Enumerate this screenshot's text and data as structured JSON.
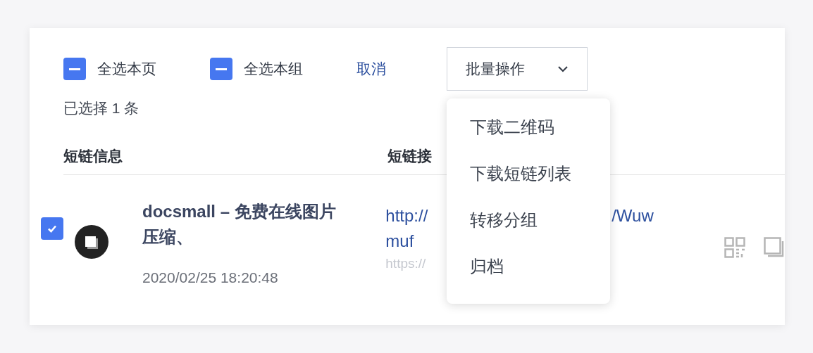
{
  "select_bar": {
    "options": [
      {
        "label": "全选本页",
        "indeterminate": true
      },
      {
        "label": "全选本组",
        "indeterminate": true
      }
    ],
    "cancel": "取消",
    "batch_button": "批量操作"
  },
  "selection_count": "已选择 1 条",
  "table": {
    "columns": [
      "短链信息",
      "短链接"
    ],
    "rows": [
      {
        "checked": true,
        "title": "docsmall – 免费在线图片压缩、",
        "time": "2020/02/25 18:20:48",
        "short_url_start": "http://",
        "short_url_end": "/Wuw",
        "short_url_line2": "muf",
        "long_url": "https://"
      }
    ]
  },
  "batch_menu": {
    "items": [
      "下载二维码",
      "下载短链列表",
      "转移分组",
      "归档"
    ]
  }
}
